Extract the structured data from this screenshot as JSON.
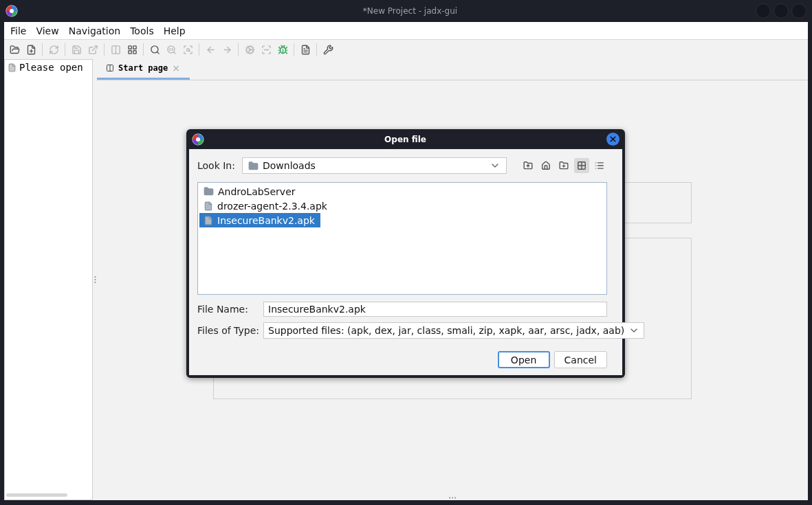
{
  "window": {
    "title": "*New Project - jadx-gui"
  },
  "menu": [
    "File",
    "View",
    "Navigation",
    "Tools",
    "Help"
  ],
  "toolbar": [
    {
      "kind": "open",
      "disabled": false
    },
    {
      "kind": "add",
      "disabled": false
    },
    {
      "kind": "sep"
    },
    {
      "kind": "reload",
      "disabled": true
    },
    {
      "kind": "sep"
    },
    {
      "kind": "save",
      "disabled": true
    },
    {
      "kind": "export",
      "disabled": true
    },
    {
      "kind": "sep"
    },
    {
      "kind": "sync",
      "disabled": true
    },
    {
      "kind": "tree",
      "disabled": false
    },
    {
      "kind": "sep"
    },
    {
      "kind": "search",
      "disabled": false
    },
    {
      "kind": "find-class",
      "disabled": true
    },
    {
      "kind": "find-usage",
      "disabled": true
    },
    {
      "kind": "sep"
    },
    {
      "kind": "back",
      "disabled": true
    },
    {
      "kind": "forward",
      "disabled": true
    },
    {
      "kind": "sep"
    },
    {
      "kind": "quark",
      "disabled": true
    },
    {
      "kind": "preview",
      "disabled": true
    },
    {
      "kind": "debug",
      "disabled": false
    },
    {
      "kind": "sep"
    },
    {
      "kind": "log",
      "disabled": false
    },
    {
      "kind": "sep"
    },
    {
      "kind": "prefs",
      "disabled": false
    }
  ],
  "tree": {
    "items": [
      {
        "label": "Please open"
      }
    ]
  },
  "tabs": [
    {
      "label": "Start page",
      "selected": true,
      "close": "×"
    }
  ],
  "dialog": {
    "title": "Open file",
    "look_in_label": "Look In:",
    "look_in": "Downloads",
    "view_buttons": [
      {
        "kind": "up",
        "selected": false
      },
      {
        "kind": "home",
        "selected": false
      },
      {
        "kind": "new-folder",
        "selected": false
      },
      {
        "kind": "list",
        "selected": true
      },
      {
        "kind": "details",
        "selected": false
      }
    ],
    "files": [
      {
        "name": "AndroLabServer",
        "kind": "folder",
        "selected": false
      },
      {
        "name": "drozer-agent-2.3.4.apk",
        "kind": "file",
        "selected": false
      },
      {
        "name": "InsecureBankv2.apk",
        "kind": "file",
        "selected": true
      }
    ],
    "file_name_label": "File Name:",
    "file_name": "InsecureBankv2.apk",
    "file_type_label": "Files of Type:",
    "file_type": "Supported files: (apk, dex, jar, class, smali, zip, xapk, aar, arsc, jadx, aab)",
    "buttons": [
      {
        "label": "Open",
        "default": true
      },
      {
        "label": "Cancel",
        "default": false
      }
    ]
  }
}
